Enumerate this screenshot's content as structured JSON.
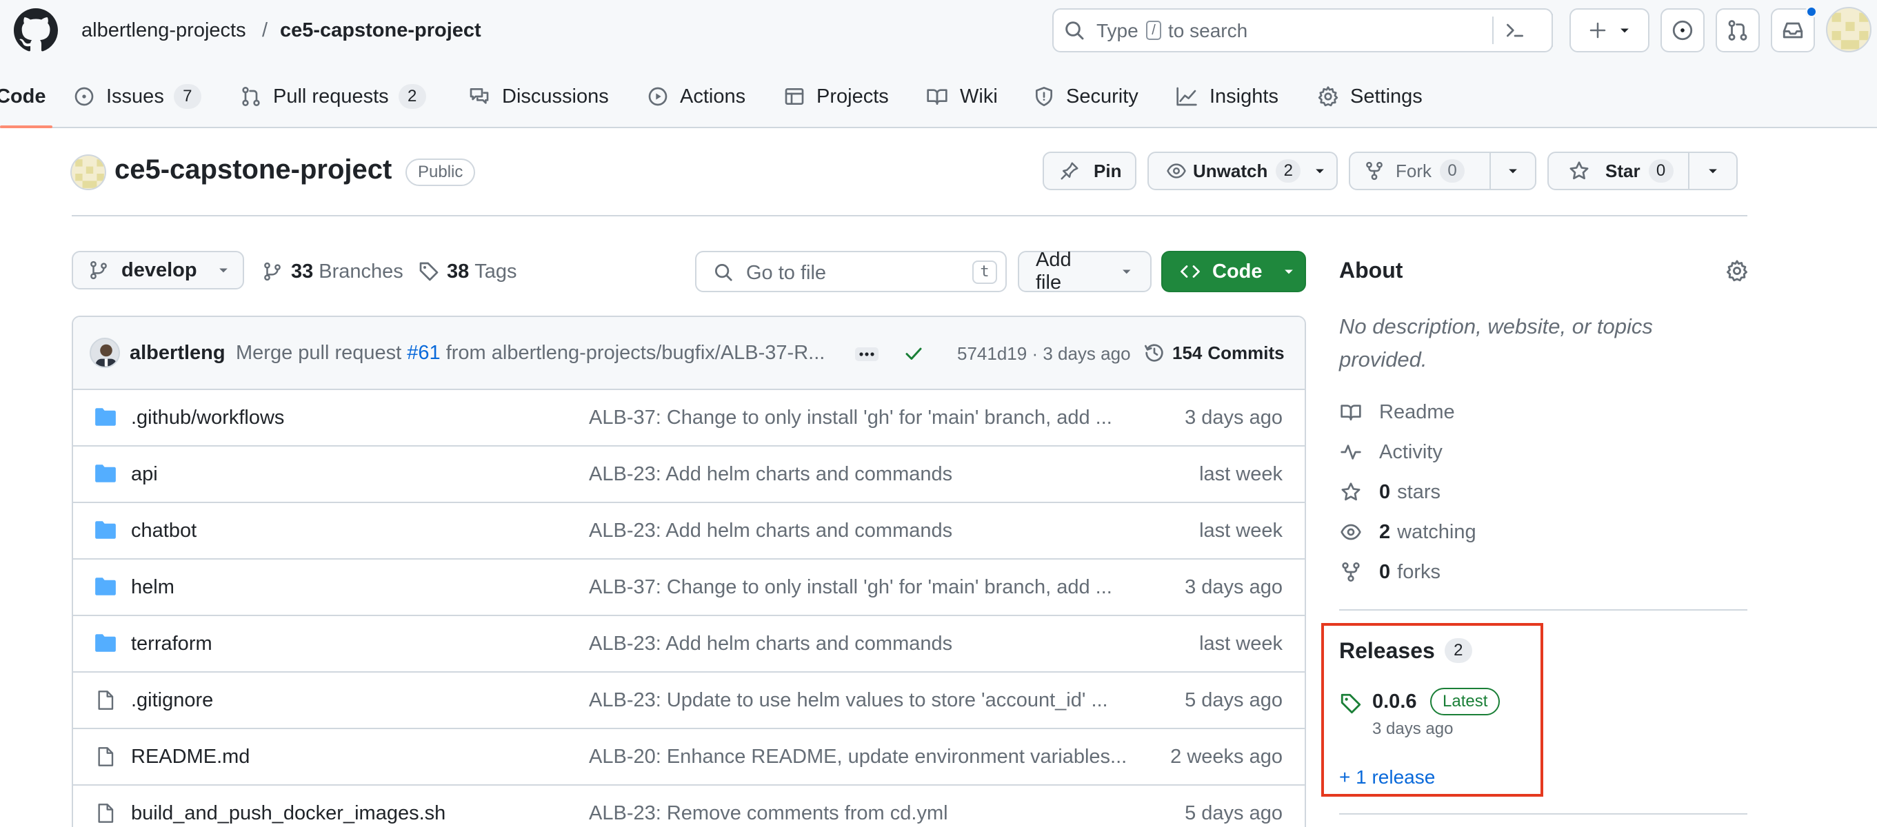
{
  "header": {
    "owner": "albertleng-projects",
    "separator": "/",
    "repo": "ce5-capstone-project",
    "search_prefix": "Type",
    "search_key": "/",
    "search_suffix": "to search"
  },
  "nav": {
    "tabs": [
      {
        "label": "Code",
        "icon": "code-icon"
      },
      {
        "label": "Issues",
        "count": "7",
        "icon": "issue-icon"
      },
      {
        "label": "Pull requests",
        "count": "2",
        "icon": "pull-request-icon"
      },
      {
        "label": "Discussions",
        "icon": "discussion-icon"
      },
      {
        "label": "Actions",
        "icon": "play-icon"
      },
      {
        "label": "Projects",
        "icon": "table-icon"
      },
      {
        "label": "Wiki",
        "icon": "book-icon"
      },
      {
        "label": "Security",
        "icon": "shield-icon"
      },
      {
        "label": "Insights",
        "icon": "graph-icon"
      },
      {
        "label": "Settings",
        "icon": "gear-icon"
      }
    ]
  },
  "repo_header": {
    "name": "ce5-capstone-project",
    "visibility": "Public",
    "pin_label": "Pin",
    "unwatch_label": "Unwatch",
    "unwatch_count": "2",
    "fork_label": "Fork",
    "fork_count": "0",
    "star_label": "Star",
    "star_count": "0"
  },
  "toolbar": {
    "branch": "develop",
    "branches_count": "33",
    "branches_label": "Branches",
    "tags_count": "38",
    "tags_label": "Tags",
    "goto_placeholder": "Go to file",
    "goto_key": "t",
    "add_file_label": "Add file",
    "code_label": "Code"
  },
  "commit": {
    "author": "albertleng",
    "message_prefix": "Merge pull request",
    "pr_link": "#61",
    "message_suffix": "from albertleng-projects/bugfix/ALB-37-R...",
    "hash_time": "5741d19 · 3 days ago",
    "commits_count": "154",
    "commits_label": "Commits"
  },
  "files": [
    {
      "name": ".github/workflows",
      "type": "folder",
      "message": "ALB-37: Change to only install 'gh' for 'main' branch, add ...",
      "age": "3 days ago"
    },
    {
      "name": "api",
      "type": "folder",
      "message": "ALB-23: Add helm charts and commands",
      "age": "last week"
    },
    {
      "name": "chatbot",
      "type": "folder",
      "message": "ALB-23: Add helm charts and commands",
      "age": "last week"
    },
    {
      "name": "helm",
      "type": "folder",
      "message": "ALB-37: Change to only install 'gh' for 'main' branch, add ...",
      "age": "3 days ago"
    },
    {
      "name": "terraform",
      "type": "folder",
      "message": "ALB-23: Add helm charts and commands",
      "age": "last week"
    },
    {
      "name": ".gitignore",
      "type": "file",
      "message": "ALB-23: Update to use helm values to store 'account_id' ...",
      "age": "5 days ago"
    },
    {
      "name": "README.md",
      "type": "file",
      "message": "ALB-20: Enhance README, update environment variables...",
      "age": "2 weeks ago"
    },
    {
      "name": "build_and_push_docker_images.sh",
      "type": "file",
      "message": "ALB-23: Remove comments from cd.yml",
      "age": "5 days ago"
    }
  ],
  "about": {
    "title": "About",
    "description_line1": "No description, website, or topics",
    "description_line2": "provided.",
    "readme": "Readme",
    "activity": "Activity",
    "stars_count": "0",
    "stars_label": "stars",
    "watching_count": "2",
    "watching_label": "watching",
    "forks_count": "0",
    "forks_label": "forks"
  },
  "releases": {
    "title": "Releases",
    "count": "2",
    "version": "0.0.6",
    "badge": "Latest",
    "time": "3 days ago",
    "more": "+ 1 release",
    "highlight_color": "#e5391f"
  },
  "colors": {
    "accent": "#0969da",
    "code_button": "#1f883d",
    "folder": "#54aeff",
    "tab_underline": "#fd8c73",
    "success": "#1a7f37",
    "notification_dot": "#0969da"
  }
}
